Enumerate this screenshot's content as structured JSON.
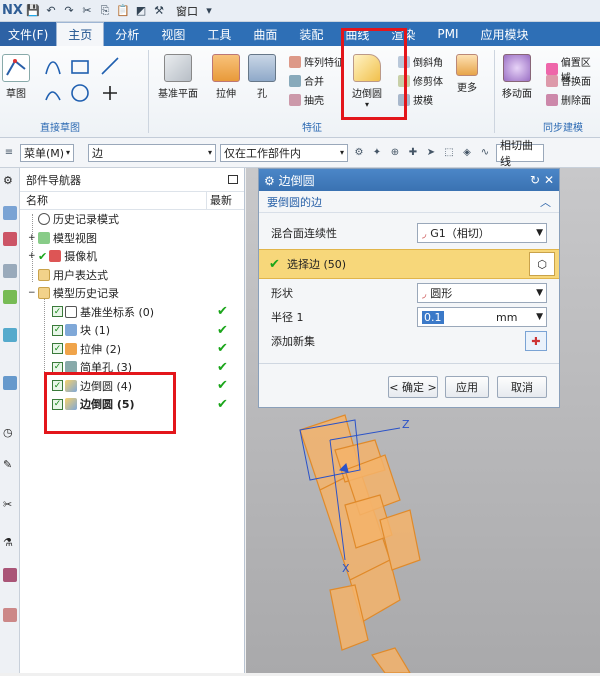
{
  "app": {
    "logo": "NX",
    "window_menu": "窗口",
    "tabs": [
      "文件(F)",
      "主页",
      "分析",
      "视图",
      "工具",
      "曲面",
      "装配",
      "曲线",
      "渲染",
      "PMI",
      "应用模块"
    ],
    "active_tab": "主页"
  },
  "ribbon": {
    "sketch": {
      "big": "草图",
      "group": "直接草图"
    },
    "feature": {
      "datum_plane": "基准平面",
      "extrude": "拉伸",
      "hole": "孔",
      "pattern": "阵列特征",
      "unite": "合并",
      "shell": "抽壳",
      "edge_blend": "边倒圆",
      "chamfer": "倒斜角",
      "trim_body": "修剪体",
      "draft": "拔模",
      "more": "更多",
      "group": "特征"
    },
    "sync": {
      "move_face": "移动面",
      "offset_region": "偏置区域",
      "replace_face": "替换面",
      "delete_face": "删除面",
      "group": "同步建模"
    }
  },
  "toolbar": {
    "menu": "菜单(M)",
    "filter": "边",
    "scope": "仅在工作部件内",
    "curve_rule": "相切曲线"
  },
  "navigator": {
    "title": "部件导航器",
    "col_name": "名称",
    "col_latest": "最新",
    "items": [
      {
        "label": "历史记录模式"
      },
      {
        "label": "模型视图"
      },
      {
        "label": "摄像机"
      },
      {
        "label": "用户表达式"
      },
      {
        "label": "模型历史记录"
      },
      {
        "label": "基准坐标系 (0)"
      },
      {
        "label": "块 (1)"
      },
      {
        "label": "拉伸 (2)"
      },
      {
        "label": "简单孔 (3)"
      },
      {
        "label": "边倒圆 (4)"
      },
      {
        "label": "边倒圆 (5)"
      }
    ]
  },
  "dialog": {
    "title": "边倒圆",
    "section": "要倒圆的边",
    "continuity_label": "混合面连续性",
    "continuity_value": "G1（相切）",
    "select_edge": "选择边 (50)",
    "shape_label": "形状",
    "shape_value": "圆形",
    "radius_label": "半径 1",
    "radius_value": "0.1",
    "radius_unit": "mm",
    "add_new_set": "添加新集",
    "ok": "< 确定 >",
    "apply": "应用",
    "cancel": "取消"
  },
  "viewport": {
    "axis_z": "Z",
    "axis_x": "X"
  },
  "colors": {
    "accent": "#2e6fb6",
    "highlight": "#f7d77a",
    "part": "#f5a95a",
    "check": "#1aa51a"
  }
}
